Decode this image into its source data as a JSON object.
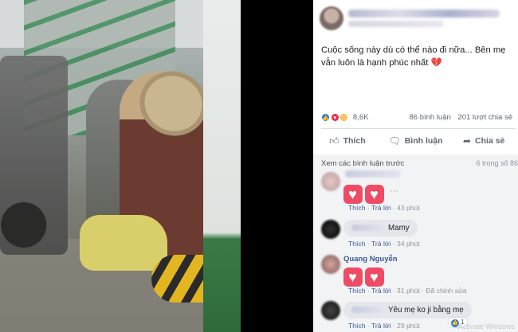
{
  "post": {
    "text": "Cuộc sống này dù có thể nào đi nữa... Bên mẹ vẫn luôn là hạnh phúc nhất",
    "emoji": "💔"
  },
  "reactions": {
    "count": "8,6K",
    "comments": "86 bình luận",
    "shares": "201 lượt chia sẻ"
  },
  "actions": {
    "like": "Thích",
    "comment": "Bình luận",
    "share": "Chia sẻ"
  },
  "comments_section": {
    "view_previous": "Xem các bình luận trước",
    "page_count": "6 trong số 86",
    "items": [
      {
        "name": "",
        "body": "♥♥",
        "like": "Thích",
        "reply": "Trả lời",
        "time": "43 phút",
        "extra": ""
      },
      {
        "name": "",
        "body": "Mamy",
        "like": "Thích",
        "reply": "Trả lời",
        "time": "34 phút",
        "extra": ""
      },
      {
        "name": "Quang Nguyễn",
        "body": "♥♥",
        "like": "Thích",
        "reply": "Trả lời",
        "time": "31 phút",
        "extra": "Đã chỉnh sửa"
      },
      {
        "name": "",
        "body": "Yêu mẹ ko ji bằng mẹ",
        "like": "Thích",
        "reply": "Trả lời",
        "time": "29 phút",
        "extra": ""
      }
    ],
    "last_like_count": "1"
  },
  "watermark": "Activate Windows",
  "colors": {
    "accent": "#385898",
    "love": "#f02849",
    "like": "#1877f2"
  },
  "icons": {
    "like": "thumbs-up-icon",
    "comment": "comment-bubble-icon",
    "share": "share-arrow-icon",
    "more": "more-dots-icon"
  }
}
